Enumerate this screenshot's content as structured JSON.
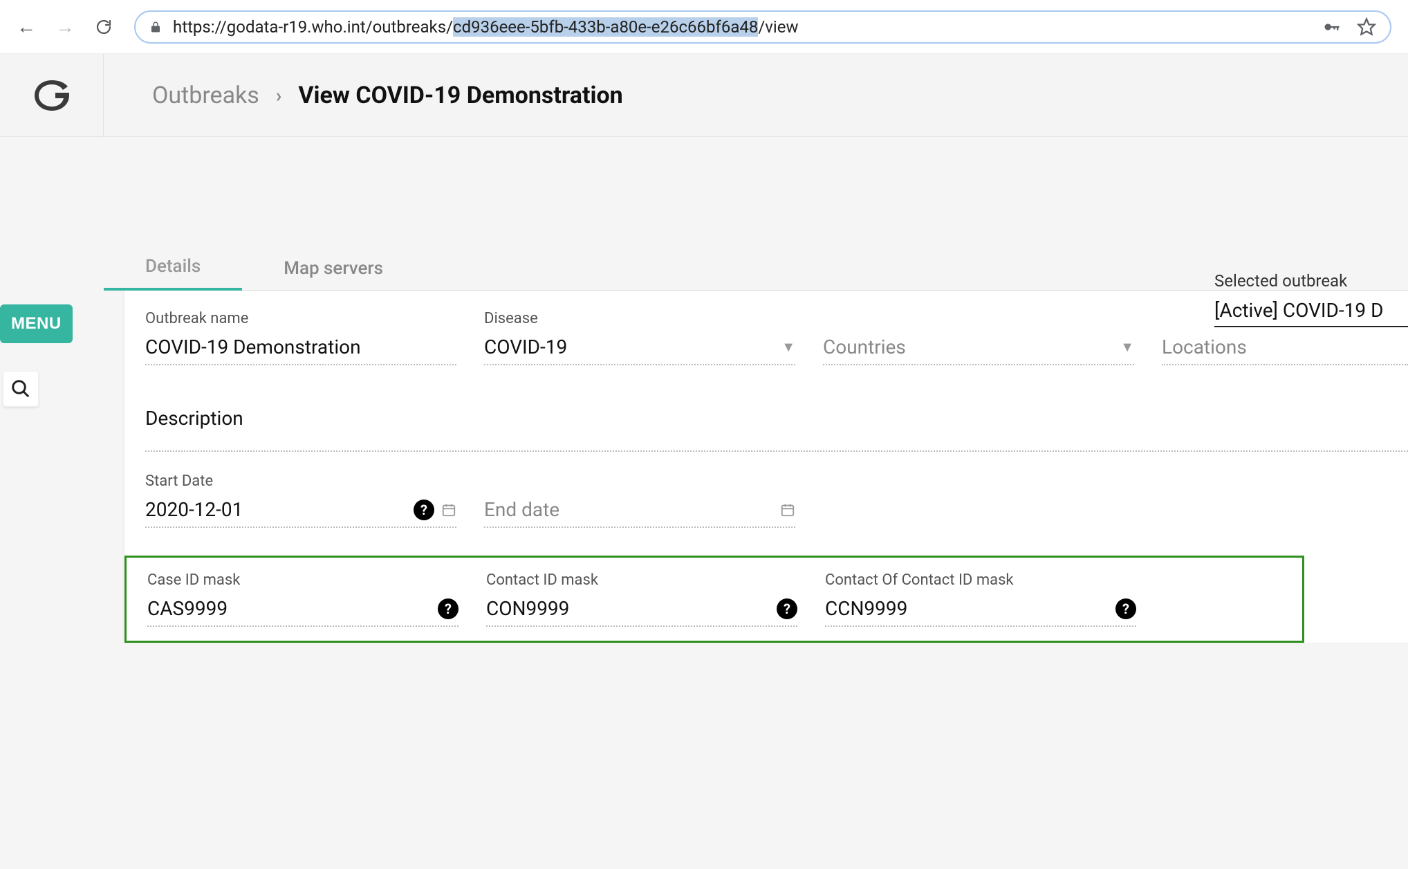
{
  "browser": {
    "url_prefix": "https://godata-r19.who.int/outbreaks/",
    "url_selected": "cd936eee-5bfb-433b-a80e-e26c66bf6a48",
    "url_suffix": "/view"
  },
  "breadcrumb": {
    "root": "Outbreaks",
    "current": "View COVID-19 Demonstration"
  },
  "menu_label": "MENU",
  "selected_outbreak": {
    "label": "Selected outbreak",
    "value": "[Active] COVID-19 D"
  },
  "tabs": [
    {
      "label": "Details",
      "active": true
    },
    {
      "label": "Map servers",
      "active": false
    }
  ],
  "fields": {
    "outbreak_name": {
      "label": "Outbreak name",
      "value": "COVID-19 Demonstration"
    },
    "disease": {
      "label": "Disease",
      "value": "COVID-19"
    },
    "countries": {
      "label": "",
      "placeholder": "Countries"
    },
    "locations": {
      "label": "",
      "placeholder": "Locations"
    },
    "description": {
      "label": "Description"
    },
    "start_date": {
      "label": "Start Date",
      "value": "2020-12-01"
    },
    "end_date": {
      "label": "",
      "placeholder": "End date"
    },
    "case_id_mask": {
      "label": "Case ID mask",
      "value": "CAS9999"
    },
    "contact_id_mask": {
      "label": "Contact ID mask",
      "value": "CON9999"
    },
    "coc_id_mask": {
      "label": "Contact Of Contact ID mask",
      "value": "CCN9999"
    }
  }
}
